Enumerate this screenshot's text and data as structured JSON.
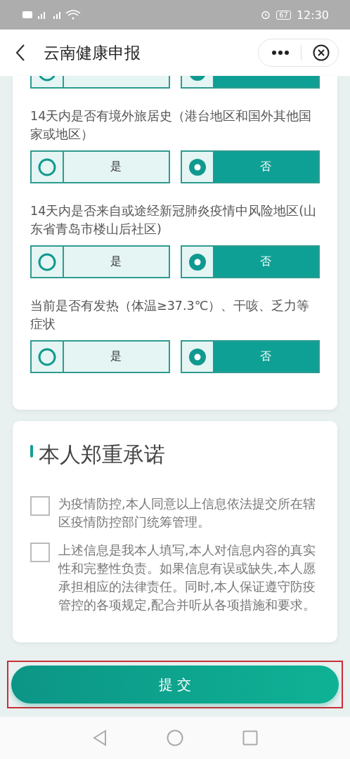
{
  "status_bar": {
    "time": "12:30",
    "battery": "67"
  },
  "header": {
    "title": "云南健康申报"
  },
  "questions": [
    {
      "options": [
        {
          "selected": false
        },
        {
          "selected": true
        }
      ]
    },
    {
      "text": "14天内是否有境外旅居史（港台地区和国外其他国家或地区）",
      "options": [
        {
          "label": "是",
          "selected": false
        },
        {
          "label": "否",
          "selected": true
        }
      ]
    },
    {
      "text": "14天内是否来自或途经新冠肺炎疫情中风险地区(山东省青岛市楼山后社区)",
      "options": [
        {
          "label": "是",
          "selected": false
        },
        {
          "label": "否",
          "selected": true
        }
      ]
    },
    {
      "text": "当前是否有发热（体温≥37.3℃）、干咳、乏力等症状",
      "options": [
        {
          "label": "是",
          "selected": false
        },
        {
          "label": "否",
          "selected": true
        }
      ]
    }
  ],
  "pledge": {
    "title": "本人郑重承诺",
    "items": [
      {
        "text": "为疫情防控,本人同意以上信息依法提交所在辖区疫情防控部门统筹管理。",
        "checked": false
      },
      {
        "text": "上述信息是我本人填写,本人对信息内容的真实性和完整性负责。如果信息有误或缺失,本人愿承担相应的法律责任。同时,本人保证遵守防疫管控的各项规定,配合并听从各项措施和要求。",
        "checked": false
      }
    ]
  },
  "submit": {
    "label": "提 交",
    "highlighted": true
  }
}
